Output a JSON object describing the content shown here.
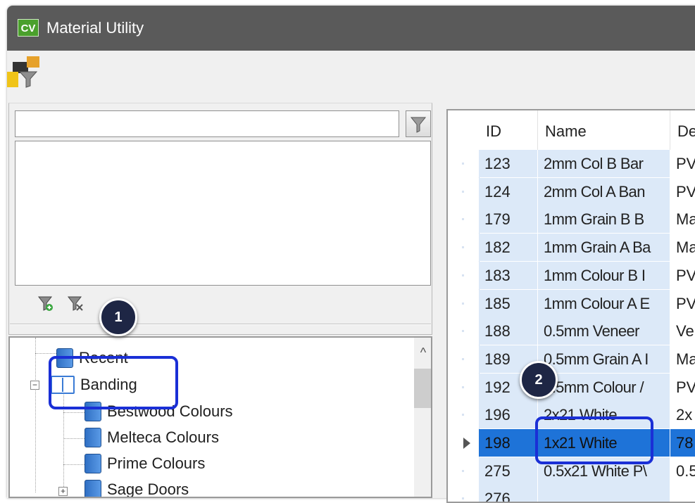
{
  "window": {
    "title": "Material Utility",
    "logo_text": "CV"
  },
  "filter": {
    "search_value": ""
  },
  "tree": {
    "items": [
      {
        "label": "Recent"
      },
      {
        "label": "Banding"
      },
      {
        "label": "Bestwood Colours"
      },
      {
        "label": "Melteca Colours"
      },
      {
        "label": "Prime Colours"
      },
      {
        "label": "Sage Doors"
      }
    ],
    "expander_minus": "−",
    "expander_plus": "+",
    "scroll_up": "^"
  },
  "grid": {
    "columns": [
      "ID",
      "Name",
      "De"
    ],
    "rows": [
      {
        "id": "123",
        "name": "2mm Col B Bar",
        "desc": "PV"
      },
      {
        "id": "124",
        "name": "2mm Col A Ban",
        "desc": "PV"
      },
      {
        "id": "179",
        "name": "1mm Grain B B",
        "desc": "Ma"
      },
      {
        "id": "182",
        "name": "1mm Grain A Ba",
        "desc": "Ma"
      },
      {
        "id": "183",
        "name": "1mm Colour B I",
        "desc": "PV"
      },
      {
        "id": "185",
        "name": "1mm Colour A E",
        "desc": "PV"
      },
      {
        "id": "188",
        "name": "0.5mm Veneer",
        "desc": "Ve"
      },
      {
        "id": "189",
        "name": "0.5mm Grain A I",
        "desc": "Ma"
      },
      {
        "id": "192",
        "name": "0.5mm Colour /",
        "desc": "PV"
      },
      {
        "id": "196",
        "name": "2x21 White",
        "desc": "2x"
      },
      {
        "id": "198",
        "name": "1x21 White",
        "desc": "78"
      },
      {
        "id": "275",
        "name": "0.5x21 White P\\",
        "desc": "0.5"
      },
      {
        "id": "276",
        "name": "",
        "desc": ""
      }
    ],
    "selected_id": "198"
  },
  "annotations": {
    "callout_1": "1",
    "callout_2": "2"
  },
  "colors": {
    "titlebar": "#5a5a5a",
    "selection": "#1e73d8",
    "alt_row": "#dce9f8",
    "callout": "#1e2645",
    "highlight": "#1a2fd6"
  }
}
